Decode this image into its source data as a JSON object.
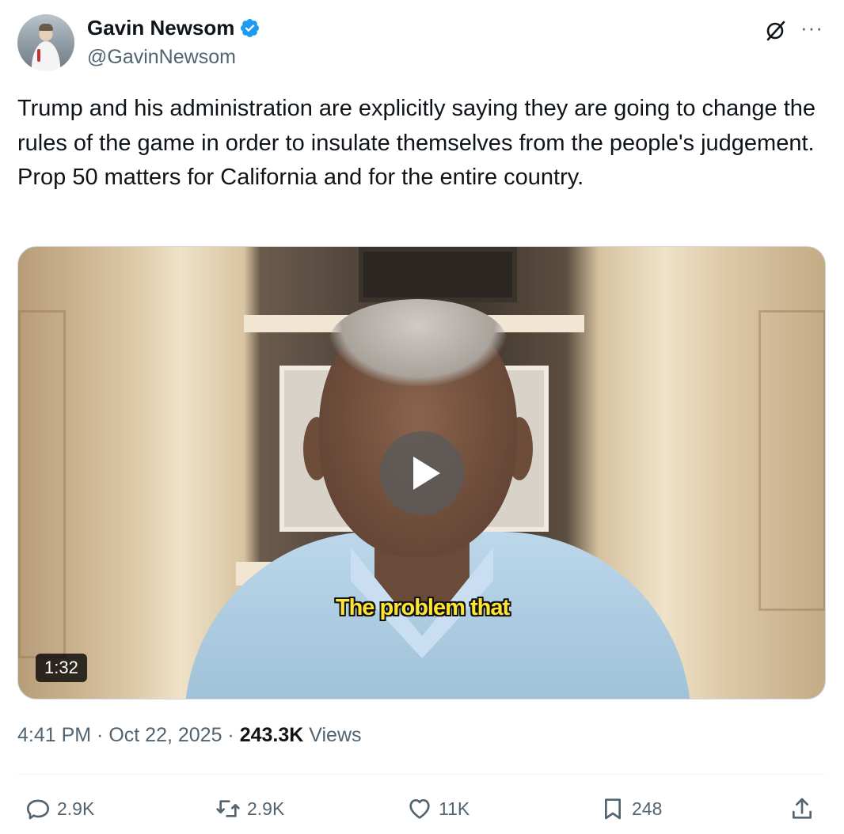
{
  "author": {
    "name": "Gavin Newsom",
    "handle": "@GavinNewsom",
    "verified_color": "#1d9bf0"
  },
  "icons": {
    "verified": "verified-badge-icon",
    "grok": "grok-icon",
    "more": "more-options-icon",
    "reply": "reply-icon",
    "retweet": "retweet-icon",
    "like": "like-icon",
    "bookmark": "bookmark-icon",
    "share": "share-icon"
  },
  "tweet": {
    "text": "Trump and his administration are explicitly saying they are going to change the rules of the game in order to insulate themselves from the people's judgement. Prop 50 matters for California and for the entire country."
  },
  "video": {
    "caption": "The problem that",
    "duration": "1:32"
  },
  "meta": {
    "time": "4:41 PM",
    "separator1": " · ",
    "date": "Oct 22, 2025",
    "separator2": " · ",
    "views_count": "243.3K",
    "views_label": "Views"
  },
  "actions": {
    "replies": "2.9K",
    "retweets": "2.9K",
    "likes": "11K",
    "bookmarks": "248"
  }
}
